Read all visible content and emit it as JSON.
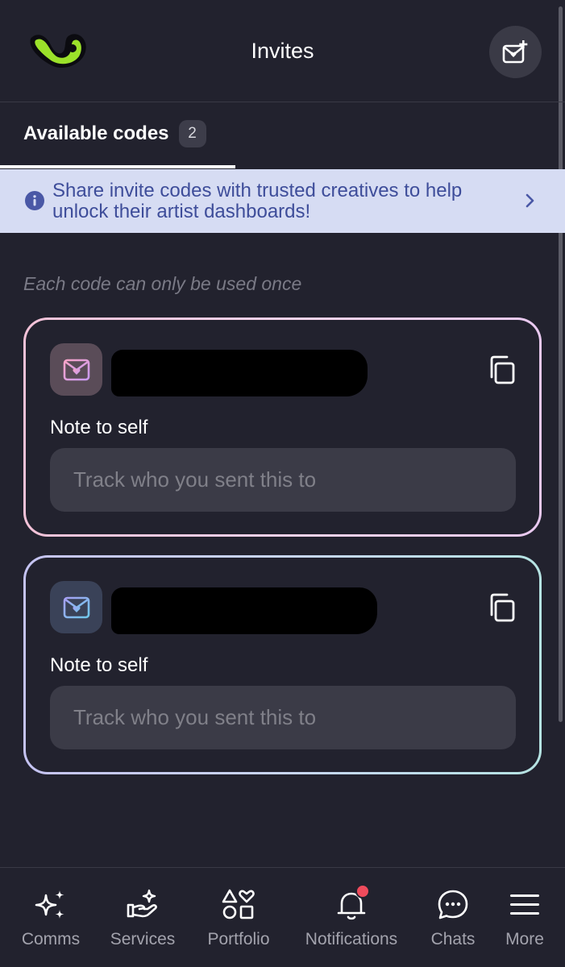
{
  "header": {
    "title": "Invites",
    "logo_icon": "app-logo-icon",
    "action_icon": "envelope-plus-icon"
  },
  "tabs": [
    {
      "label": "Available codes",
      "count": "2",
      "active": true
    }
  ],
  "banner": {
    "text": "Share invite codes with trusted creatives to help unlock their artist dashboards!",
    "icon": "info-icon",
    "chevron": "chevron-right-icon"
  },
  "hint": "Each code can only be used once",
  "codes": [
    {
      "icon": "envelope-heart-icon",
      "code": "[redacted]",
      "note_label": "Note to self",
      "note_placeholder": "Track who you sent this to",
      "border_colors": [
        "#f3c2d8",
        "#e9c9f0"
      ]
    },
    {
      "icon": "envelope-heart-icon",
      "code": "[redacted]",
      "note_label": "Note to self",
      "note_placeholder": "Track who you sent this to",
      "border_colors": [
        "#c5c3f2",
        "#b5e3e2"
      ]
    }
  ],
  "nav": [
    {
      "label": "Comms",
      "icon": "sparkles-icon"
    },
    {
      "label": "Services",
      "icon": "hand-sparkle-icon"
    },
    {
      "label": "Portfolio",
      "icon": "shapes-icon"
    },
    {
      "label": "Notifications",
      "icon": "bell-icon",
      "badge": true
    },
    {
      "label": "Chats",
      "icon": "chat-bubble-icon"
    },
    {
      "label": "More",
      "icon": "menu-icon"
    }
  ],
  "colors": {
    "background": "#22222e",
    "banner_bg": "#d6dcf3",
    "banner_text": "#3e4d9a",
    "accent_green": "#9be12a",
    "badge_red": "#ef4b5c"
  }
}
